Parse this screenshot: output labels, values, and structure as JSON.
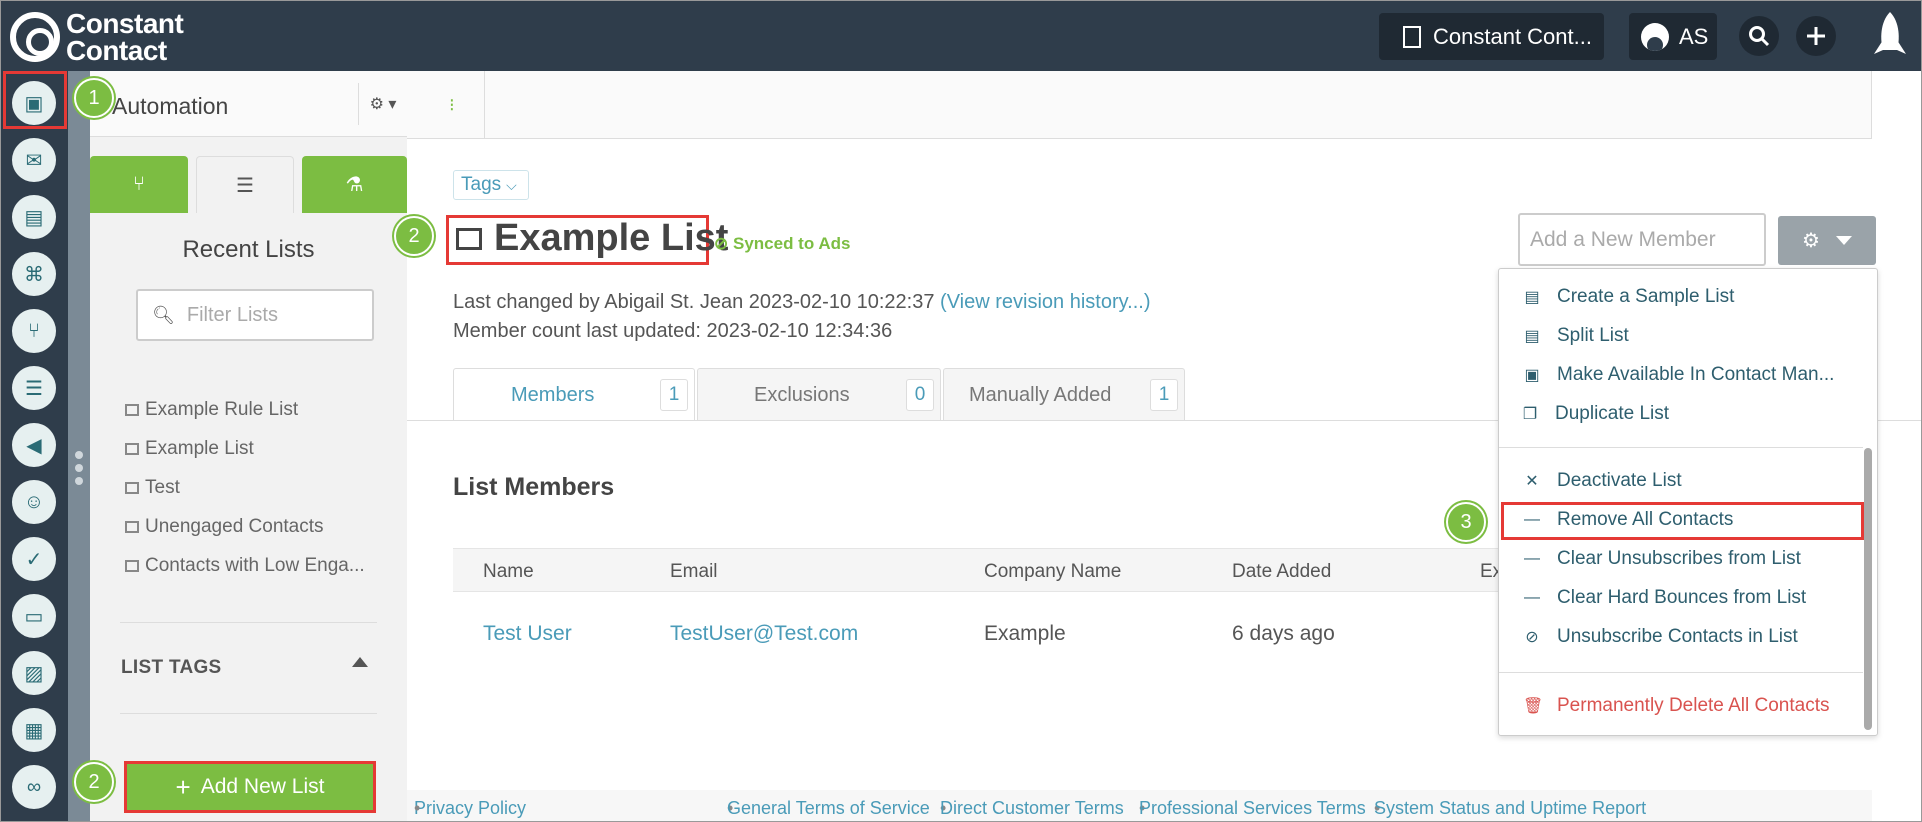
{
  "topbar": {
    "logo_line1": "Constant",
    "logo_line2": "Contact",
    "account_label": "Constant Cont...",
    "user_initials": "AS"
  },
  "rail": {
    "icons": [
      "contacts-icon",
      "email-icon",
      "clipboard-icon",
      "map-icon",
      "workflow-icon",
      "list-icon",
      "megaphone-icon",
      "chat-icon",
      "thumbs-up-icon",
      "tv-icon",
      "image-icon",
      "calendar-icon",
      "handshake-icon"
    ]
  },
  "left_panel": {
    "title": "Automation",
    "recent_lists_title": "Recent Lists",
    "filter_placeholder": "Filter Lists",
    "recent_lists": [
      "Example Rule List",
      "Example List",
      "Test",
      "Unengaged Contacts",
      "Contacts with Low Enga..."
    ],
    "list_tags_title": "LIST TAGS",
    "add_new_list_label": "Add New List"
  },
  "main": {
    "tags_label": "Tags",
    "list_title": "Example List",
    "synced_label": "Synced to Ads",
    "last_changed_text": "Last changed by Abigail St. Jean 2023-02-10 10:22:37",
    "revision_link": "(View revision history...)",
    "member_count_text": "Member count last updated: 2023-02-10 12:34:36",
    "add_member_placeholder": "Add a New Member",
    "tabs": [
      {
        "label": "Members",
        "count": "1"
      },
      {
        "label": "Exclusions",
        "count": "0"
      },
      {
        "label": "Manually Added",
        "count": "1"
      }
    ],
    "list_members_title": "List Members",
    "table": {
      "headers": [
        "Name",
        "Email",
        "Company Name",
        "Date Added",
        "Ex"
      ],
      "rows": [
        {
          "name": "Test User",
          "email": "TestUser@Test.com",
          "company": "Example",
          "date_added": "6 days ago"
        }
      ]
    }
  },
  "dropdown": {
    "items": [
      {
        "label": "Create a Sample List",
        "icon": "list-icon"
      },
      {
        "label": "Split List",
        "icon": "list-icon"
      },
      {
        "label": "Make Available In Contact Man...",
        "icon": "contact-card-icon"
      },
      {
        "label": "Duplicate List",
        "icon": "copy-icon"
      },
      {
        "label": "Deactivate List",
        "icon": "close-icon"
      },
      {
        "label": "Remove All Contacts",
        "icon": "minus-icon"
      },
      {
        "label": "Clear Unsubscribes from List",
        "icon": "minus-icon"
      },
      {
        "label": "Clear Hard Bounces from List",
        "icon": "minus-icon"
      },
      {
        "label": "Unsubscribe Contacts in List",
        "icon": "ban-icon"
      },
      {
        "label": "Permanently Delete All Contacts",
        "icon": "trash-icon"
      }
    ]
  },
  "footer": {
    "privacy": "Privacy Policy",
    "general_terms": "General Terms of Service",
    "direct_terms": "Direct Customer Terms",
    "professional_terms": "Professional Services Terms",
    "status": "System Status and Uptime Report"
  },
  "callouts": [
    "1",
    "2",
    "2",
    "3"
  ],
  "colors": {
    "topbar": "#2f3d4b",
    "accent_green": "#7cbd42",
    "link_blue": "#4a9bb8",
    "highlight_red": "#e53935",
    "danger_red": "#d9534f"
  }
}
